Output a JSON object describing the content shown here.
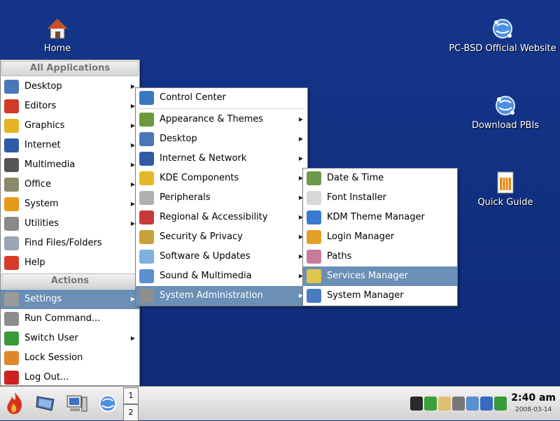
{
  "desktop": {
    "icons": [
      {
        "label": "Home",
        "icon": "home-icon"
      },
      {
        "label": "PC-BSD Official Website",
        "icon": "globe-icon"
      },
      {
        "label": "Download PBIs",
        "icon": "globe-icon"
      },
      {
        "label": "Quick Guide",
        "icon": "document-icon"
      }
    ]
  },
  "main_menu": {
    "header_all": "All Applications",
    "items": [
      {
        "label": "Desktop",
        "has_sub": true,
        "icon": "desktop-icon",
        "color": "#4b77b8"
      },
      {
        "label": "Editors",
        "has_sub": true,
        "icon": "editor-icon",
        "color": "#d23a2a"
      },
      {
        "label": "Graphics",
        "has_sub": true,
        "icon": "graphics-icon",
        "color": "#e6b325"
      },
      {
        "label": "Internet",
        "has_sub": true,
        "icon": "internet-icon",
        "color": "#2e5aa6"
      },
      {
        "label": "Multimedia",
        "has_sub": true,
        "icon": "multimedia-icon",
        "color": "#555555"
      },
      {
        "label": "Office",
        "has_sub": true,
        "icon": "office-icon",
        "color": "#8a8a6a"
      },
      {
        "label": "System",
        "has_sub": true,
        "icon": "system-icon",
        "color": "#e59a1a"
      },
      {
        "label": "Utilities",
        "has_sub": true,
        "icon": "utilities-icon",
        "color": "#8a8a8a"
      },
      {
        "label": "Find Files/Folders",
        "has_sub": false,
        "icon": "find-icon",
        "color": "#9aa6b3"
      },
      {
        "label": "Help",
        "has_sub": false,
        "icon": "help-icon",
        "color": "#d93b2b"
      }
    ],
    "header_actions": "Actions",
    "actions": [
      {
        "label": "Settings",
        "has_sub": true,
        "selected": true,
        "icon": "settings-icon",
        "color": "#9a9a9a"
      },
      {
        "label": "Run Command...",
        "has_sub": false,
        "icon": "run-icon",
        "color": "#8d8d8d"
      },
      {
        "label": "Switch User",
        "has_sub": true,
        "icon": "switch-user-icon",
        "color": "#3a9a3a"
      },
      {
        "label": "Lock Session",
        "has_sub": false,
        "icon": "lock-icon",
        "color": "#e0862a"
      },
      {
        "label": "Log Out...",
        "has_sub": false,
        "icon": "logout-icon",
        "color": "#cc2222"
      }
    ]
  },
  "settings_menu": {
    "items": [
      {
        "label": "Control Center",
        "has_sub": false,
        "icon": "control-center-icon",
        "color": "#3b78c2"
      },
      {
        "label": "Appearance & Themes",
        "has_sub": true,
        "icon": "appearance-icon",
        "color": "#6c9a3a"
      },
      {
        "label": "Desktop",
        "has_sub": true,
        "icon": "desktop-icon",
        "color": "#4b77b8"
      },
      {
        "label": "Internet & Network",
        "has_sub": true,
        "icon": "network-icon",
        "color": "#2e5aa6"
      },
      {
        "label": "KDE Components",
        "has_sub": true,
        "icon": "components-icon",
        "color": "#e5b82a"
      },
      {
        "label": "Peripherals",
        "has_sub": true,
        "icon": "printer-icon",
        "color": "#b0b0b0"
      },
      {
        "label": "Regional & Accessibility",
        "has_sub": true,
        "icon": "flag-icon",
        "color": "#c73a3a"
      },
      {
        "label": "Security & Privacy",
        "has_sub": true,
        "icon": "security-icon",
        "color": "#c9a13a"
      },
      {
        "label": "Software & Updates",
        "has_sub": true,
        "icon": "software-icon",
        "color": "#7fb0e0"
      },
      {
        "label": "Sound & Multimedia",
        "has_sub": true,
        "icon": "sound-icon",
        "color": "#5a8fd0"
      },
      {
        "label": "System Administration",
        "has_sub": true,
        "selected": true,
        "icon": "sysadmin-icon",
        "color": "#8f8f8f"
      }
    ]
  },
  "sysadmin_menu": {
    "items": [
      {
        "label": "Date & Time",
        "icon": "calendar-icon",
        "color": "#6a9a4a"
      },
      {
        "label": "Font Installer",
        "icon": "font-icon",
        "color": "#d8d8d8"
      },
      {
        "label": "KDM Theme Manager",
        "icon": "users-icon",
        "color": "#3a7ad0"
      },
      {
        "label": "Login Manager",
        "icon": "users-icon",
        "color": "#e5a02a"
      },
      {
        "label": "Paths",
        "icon": "paths-icon",
        "color": "#c77a9a"
      },
      {
        "label": "Services Manager",
        "icon": "services-icon",
        "color": "#e0c64a",
        "selected": true
      },
      {
        "label": "System Manager",
        "icon": "monitor-icon",
        "color": "#4a7ac0"
      }
    ]
  },
  "taskbar": {
    "pager": [
      "1",
      "2"
    ],
    "clock_time": "2:40 am",
    "clock_date": "2008-03-14",
    "launchers": [
      "kmenu-icon",
      "desktop-icon",
      "computer-icon",
      "globe-icon"
    ],
    "tray": [
      {
        "icon": "battery-icon",
        "color": "#2a2a2a"
      },
      {
        "icon": "checkmark-icon",
        "color": "#3aa03a"
      },
      {
        "icon": "klipper-icon",
        "color": "#e0c070"
      },
      {
        "icon": "network-tray-icon",
        "color": "#777777"
      },
      {
        "icon": "update-icon",
        "color": "#5a8fd0"
      },
      {
        "icon": "keyboard-icon",
        "color": "#3a6abf"
      },
      {
        "icon": "display-icon",
        "color": "#3a9a3a"
      }
    ]
  },
  "colors": {
    "desktop_bg": "#13337f",
    "selection": "#6b8fb6"
  }
}
